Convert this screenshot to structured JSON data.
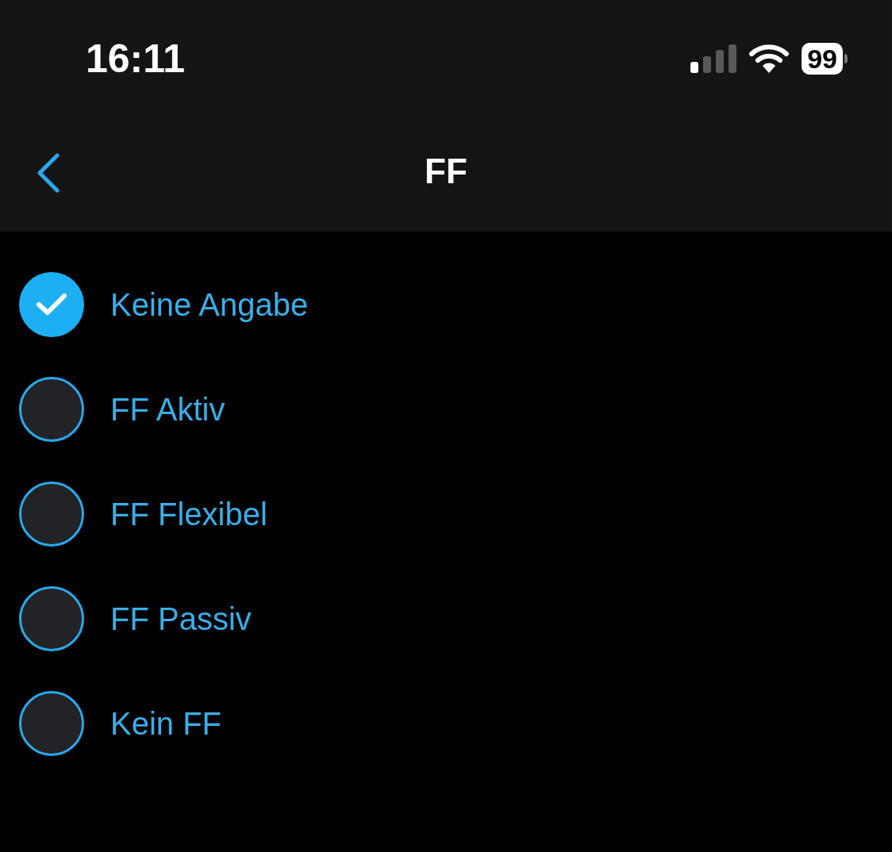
{
  "status_bar": {
    "time": "16:11",
    "battery": "99"
  },
  "nav_bar": {
    "title": "FF"
  },
  "options": [
    {
      "label": "Keine Angabe",
      "selected": true
    },
    {
      "label": "FF Aktiv",
      "selected": false
    },
    {
      "label": "FF Flexibel",
      "selected": false
    },
    {
      "label": "FF Passiv",
      "selected": false
    },
    {
      "label": "Kein FF",
      "selected": false
    }
  ]
}
